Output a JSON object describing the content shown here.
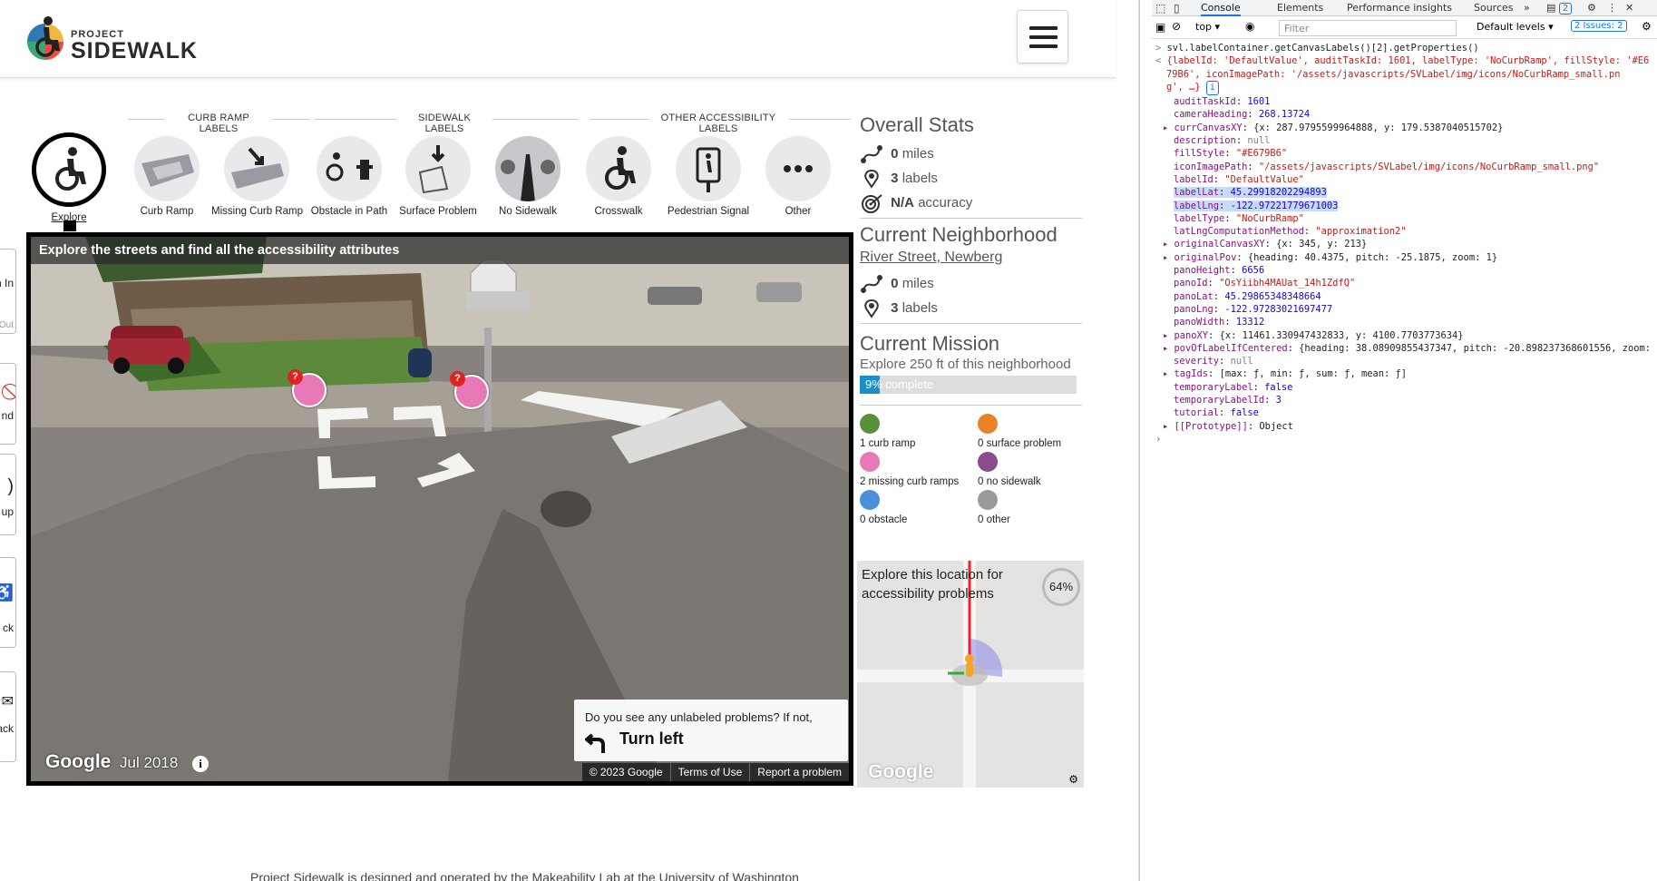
{
  "app": {
    "logo": {
      "small": "PROJECT",
      "big": "SIDEWALK"
    },
    "groups": [
      {
        "title": "CURB RAMP LABELS"
      },
      {
        "title": "SIDEWALK LABELS"
      },
      {
        "title": "OTHER ACCESSIBILITY LABELS"
      }
    ],
    "tools": [
      {
        "label": "Explore",
        "icon": "wheelchair-icon"
      },
      {
        "label": "Curb Ramp",
        "icon": "curb-ramp-icon"
      },
      {
        "label": "Missing Curb Ramp",
        "icon": "missing-curb-ramp-icon"
      },
      {
        "label": "Obstacle in Path",
        "icon": "obstacle-icon"
      },
      {
        "label": "Surface Problem",
        "icon": "surface-problem-icon"
      },
      {
        "label": "No Sidewalk",
        "icon": "no-sidewalk-icon"
      },
      {
        "label": "Crosswalk",
        "icon": "crosswalk-icon"
      },
      {
        "label": "Pedestrian Signal",
        "icon": "pedestrian-signal-icon"
      },
      {
        "label": "Other",
        "icon": "more-icon"
      }
    ],
    "side_nav": [
      "n In",
      "Out",
      "nd",
      "up",
      "ck",
      "back"
    ],
    "streetview": {
      "banner": "Explore the streets and find all the accessibility attributes",
      "google": "Google",
      "date": "Jul 2018",
      "footer": [
        "© 2023 Google",
        "Terms of Use",
        "Report a problem"
      ],
      "nav_question": "Do you see any unlabeled problems? If not,",
      "nav_action": "Turn left"
    },
    "overall": {
      "title": "Overall Stats",
      "miles": "0",
      "miles_unit": "miles",
      "labels": "3",
      "labels_unit": "labels",
      "accuracy": "N/A",
      "accuracy_unit": "accuracy"
    },
    "neighborhood": {
      "title": "Current Neighborhood",
      "name": "River Street, Newberg",
      "miles": "0",
      "miles_unit": "miles",
      "labels": "3",
      "labels_unit": "labels"
    },
    "mission": {
      "title": "Current Mission",
      "text": "Explore 250 ft of this neighborhood",
      "progress_text": "9% complete",
      "progress": 0.09
    },
    "legend": [
      {
        "text": "1 curb ramp",
        "color": "#5a8f3c"
      },
      {
        "text": "0 surface problem",
        "color": "#e8832a"
      },
      {
        "text": "2 missing curb ramps",
        "color": "#e679b6"
      },
      {
        "text": "0 no sidewalk",
        "color": "#8a4b8f"
      },
      {
        "text": "0 obstacle",
        "color": "#4a90d9"
      },
      {
        "text": "0 other",
        "color": "#9a9a9a"
      }
    ],
    "minimap": {
      "message": "Explore this location for accessibility problems",
      "percent": "64%",
      "google": "Google"
    },
    "footer": "Project Sidewalk is designed and operated by the Makeability Lab at the University of Washington"
  },
  "devtools": {
    "tabs": [
      "Console",
      "Elements",
      "Performance insights",
      "Sources",
      "»"
    ],
    "badge": "2",
    "context": "top",
    "filter_placeholder": "Filter",
    "levels": "Default levels",
    "issues": "2 Issues: 2",
    "command": "svl.labelContainer.getCanvasLabels()[2].getProperties()",
    "summary1": "{labelId: 'DefaultValue', auditTaskId: 1601, labelType: 'NoCurbRamp', fillStyle: '#E6",
    "summary2": "79B6', iconImagePath: '/assets/javascripts/SVLabel/img/icons/NoCurbRamp_small.pn",
    "summary3": "g', …}",
    "props": [
      {
        "key": "auditTaskId",
        "val": "1601",
        "type": "n"
      },
      {
        "key": "cameraHeading",
        "val": "268.13724",
        "type": "n"
      },
      {
        "key": "▸ currCanvasXY",
        "val": "{x: 287.9795599964888, y: 179.5387040515702}",
        "type": "o"
      },
      {
        "key": "description",
        "val": "null",
        "type": "g"
      },
      {
        "key": "fillStyle",
        "val": "\"#E679B6\"",
        "type": "s"
      },
      {
        "key": "iconImagePath",
        "val": "\"/assets/javascripts/SVLabel/img/icons/NoCurbRamp_small.png\"",
        "type": "s"
      },
      {
        "key": "labelId",
        "val": "\"DefaultValue\"",
        "type": "s"
      },
      {
        "key": "labelLat",
        "val": "45.29918202294893",
        "type": "sel"
      },
      {
        "key": "labelLng",
        "val": "-122.97221779671003",
        "type": "sel"
      },
      {
        "key": "labelType",
        "val": "\"NoCurbRamp\"",
        "type": "s"
      },
      {
        "key": "latLngComputationMethod",
        "val": "\"approximation2\"",
        "type": "s"
      },
      {
        "key": "▸ originalCanvasXY",
        "val": "{x: 345, y: 213}",
        "type": "o"
      },
      {
        "key": "▸ originalPov",
        "val": "{heading: 40.4375, pitch: -25.1875, zoom: 1}",
        "type": "o"
      },
      {
        "key": "panoHeight",
        "val": "6656",
        "type": "n"
      },
      {
        "key": "panoId",
        "val": "\"OsYiibh4MAUat_14h1ZdfQ\"",
        "type": "s"
      },
      {
        "key": "panoLat",
        "val": "45.29865348348664",
        "type": "n"
      },
      {
        "key": "panoLng",
        "val": "-122.97283021697477",
        "type": "n"
      },
      {
        "key": "panoWidth",
        "val": "13312",
        "type": "n"
      },
      {
        "key": "▸ panoXY",
        "val": "{x: 11461.330947432833, y: 4100.7703773634}",
        "type": "o"
      },
      {
        "key": "▸ povOfLabelIfCentered",
        "val": "{heading: 38.08909855437347, pitch: -20.898237368601556, zoom:",
        "type": "o"
      },
      {
        "key": "severity",
        "val": "null",
        "type": "g"
      },
      {
        "key": "▸ tagIds",
        "val": "[max: ƒ, min: ƒ, sum: ƒ, mean: ƒ]",
        "type": "o"
      },
      {
        "key": "temporaryLabel",
        "val": "false",
        "type": "n"
      },
      {
        "key": "temporaryLabelId",
        "val": "3",
        "type": "n"
      },
      {
        "key": "tutorial",
        "val": "false",
        "type": "n"
      },
      {
        "key": "▸ [[Prototype]]",
        "val": "Object",
        "type": "o"
      }
    ]
  }
}
